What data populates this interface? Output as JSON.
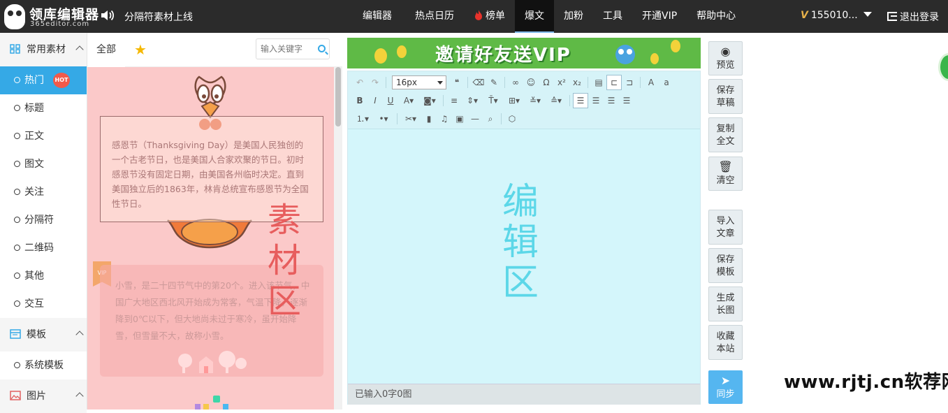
{
  "brand": {
    "name": "领库编辑器",
    "domain": "365editor.com"
  },
  "notice": "分隔符素材上线",
  "nav": [
    "编辑器",
    "热点日历",
    "榜单",
    "爆文",
    "加粉",
    "工具",
    "开通VIP",
    "帮助中心"
  ],
  "nav_active": "爆文",
  "user": {
    "vip_mark": "V",
    "name": "155010..."
  },
  "logout": "退出登录",
  "sidebar": {
    "section_material": "常用素材",
    "items": [
      "热门",
      "标题",
      "正文",
      "图文",
      "关注",
      "分隔符",
      "二维码",
      "其他",
      "交互"
    ],
    "hot_badge": "HOT",
    "section_template": "模板",
    "template_items": [
      "系统模板"
    ],
    "section_image": "图片"
  },
  "material": {
    "tab_all": "全部",
    "search_placeholder": "输入关键字",
    "card1_text": "感恩节（Thanksgiving Day）是美国人民独创的一个古老节日，也是美国人合家欢聚的节日。初时感恩节没有固定日期，由美国各州临时决定。直到美国独立后的1863年，林肯总统宣布感恩节为全国性节日。",
    "vip_badge": "VIP",
    "card2_text": "小雪，是二十四节气中的第20个。进入该节气，中国广大地区西北风开始成为常客，气温下降，逐渐降到0℃以下，但大地尚未过于寒冷，虽开始降雪，但雪量不大，故称小雪。",
    "zone_label": "素材区"
  },
  "editor": {
    "banner_text": "邀请好友送VIP",
    "font_size": "16px",
    "zone_label": "编辑区",
    "status": "已输入0字0图"
  },
  "actions": [
    "预览",
    "保存草稿",
    "复制全文",
    "清空",
    "导入文章",
    "保存模板",
    "生成长图",
    "收藏本站",
    "同步"
  ],
  "watermark": "www.rjtj.cn软荐网",
  "colors": {
    "topbar": "#2b2b2b",
    "accent": "#35a9e6",
    "material_bg": "#fbc9c9",
    "editor_bg": "#d4f6fb",
    "banner": "#5fba46"
  }
}
